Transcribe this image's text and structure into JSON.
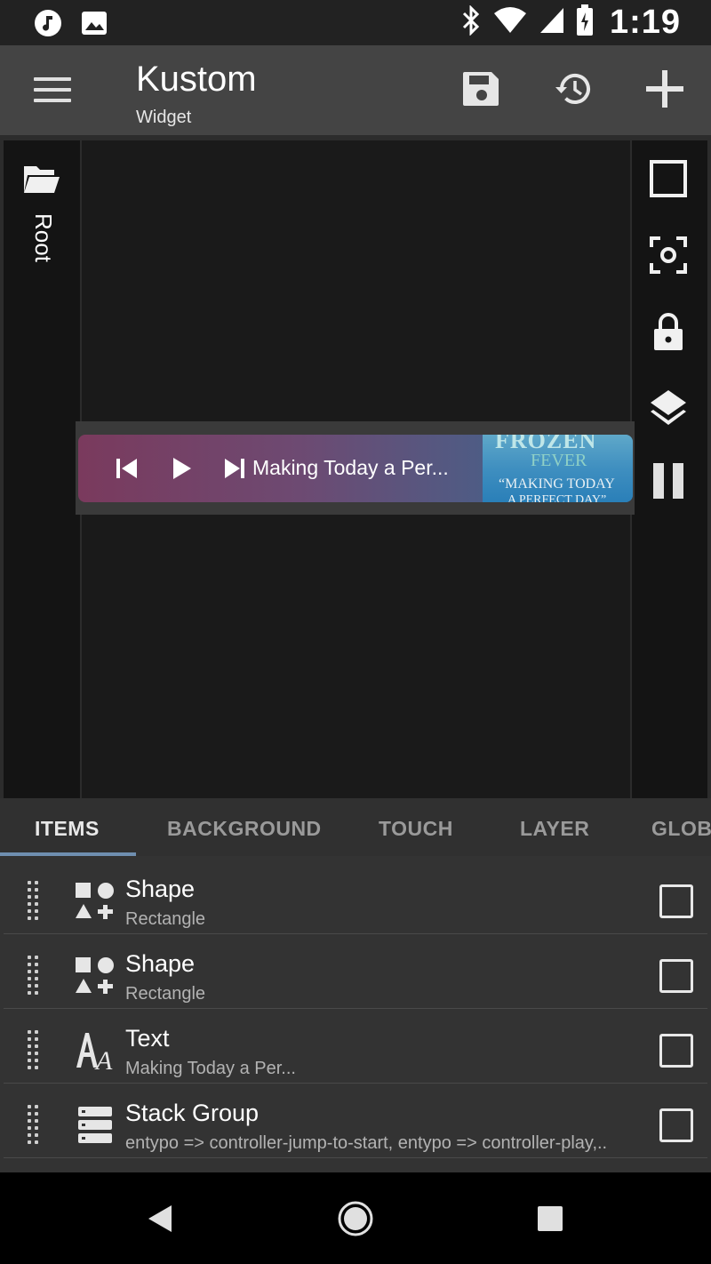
{
  "status_bar": {
    "time": "1:19",
    "icons": [
      "music-note-icon",
      "image-icon",
      "bluetooth-icon",
      "wifi-icon",
      "signal-icon",
      "battery-icon"
    ]
  },
  "app_bar": {
    "title": "Kustom",
    "subtitle": "Widget",
    "actions": [
      "save-icon",
      "history-icon",
      "add-icon"
    ]
  },
  "editor": {
    "root_label": "Root",
    "right_tools": [
      "square-outline-icon",
      "focus-icon",
      "lock-icon",
      "layers-icon",
      "pause-icon"
    ]
  },
  "widget": {
    "title": "Making Today a Per...",
    "album_art": {
      "line1": "FROZEN",
      "line2": "FEVER",
      "line3": "“MAKING TODAY",
      "line4": "A PERFECT DAY”"
    }
  },
  "tabs": [
    "ITEMS",
    "BACKGROUND",
    "TOUCH",
    "LAYER",
    "GLOBALS"
  ],
  "active_tab": "ITEMS",
  "items": [
    {
      "title": "Shape",
      "subtitle": "Rectangle",
      "icon": "shape-icon"
    },
    {
      "title": "Shape",
      "subtitle": "Rectangle",
      "icon": "shape-icon"
    },
    {
      "title": "Text",
      "subtitle": "Making Today a Per...",
      "icon": "text-icon"
    },
    {
      "title": "Stack Group",
      "subtitle": "entypo => controller-jump-to-start, entypo => controller-play,..",
      "icon": "stack-group-icon"
    }
  ],
  "nav_bar": [
    "back-icon",
    "home-icon",
    "recents-icon"
  ],
  "colors": {
    "status_bar": "#222222",
    "app_bar": "#444444",
    "canvas": "#1a1a1a",
    "list_bg": "#333333",
    "tab_indicator": "#6f8fb0"
  }
}
